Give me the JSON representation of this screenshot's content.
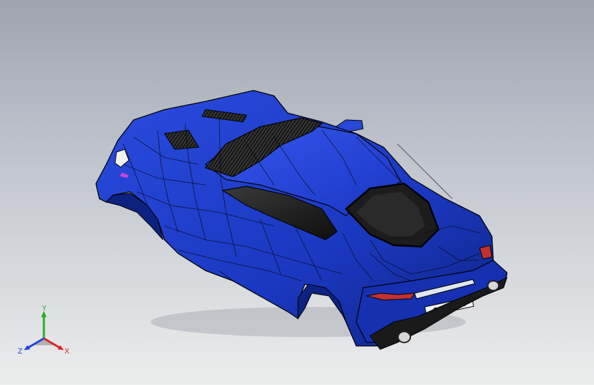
{
  "viewport": {
    "background_top": "#9ea4b0",
    "background_bottom": "#eceded"
  },
  "model": {
    "body_color": "#1f3fd0",
    "body_dark": "#0c1f8a",
    "edge_color": "#000000",
    "glass_color": "#1b1b1b",
    "rear_light_color": "#c23030",
    "plate_text": "OISON LA"
  },
  "triad": {
    "x_label": "X",
    "y_label": "Y",
    "z_label": "Z",
    "x_color": "#e02020",
    "y_color": "#20b020",
    "z_color": "#2040e0"
  }
}
